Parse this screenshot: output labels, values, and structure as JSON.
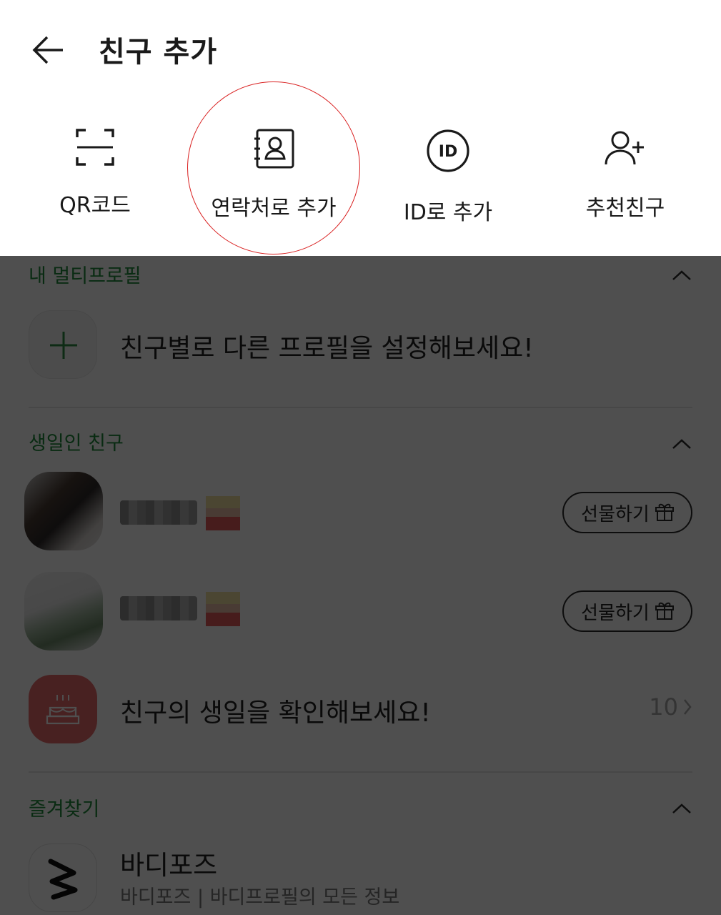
{
  "header": {
    "title": "친구 추가"
  },
  "add_options": [
    {
      "label": "QR코드",
      "icon": "qr-scan-icon"
    },
    {
      "label": "연락처로 추가",
      "icon": "contact-book-icon"
    },
    {
      "label": "ID로 추가",
      "icon": "id-badge-icon"
    },
    {
      "label": "추천친구",
      "icon": "add-person-icon"
    }
  ],
  "multiprofile": {
    "section_title": "내 멀티프로필",
    "prompt": "친구별로 다른 프로필을 설정해보세요!"
  },
  "birthdays": {
    "section_title": "생일인 친구",
    "friends": [
      {
        "gift_label": "선물하기"
      },
      {
        "gift_label": "선물하기"
      }
    ],
    "prompt": "친구의 생일을 확인해보세요!",
    "count": "10"
  },
  "favorites": {
    "section_title": "즐겨찾기",
    "items": [
      {
        "name": "바디포즈",
        "description": "바디포즈 | 바디프로필의 모든 정보"
      }
    ]
  },
  "colors": {
    "accent_green": "#1f8a3a",
    "highlight_circle": "#d91f1f",
    "birthday_tile": "#e76a6a"
  }
}
